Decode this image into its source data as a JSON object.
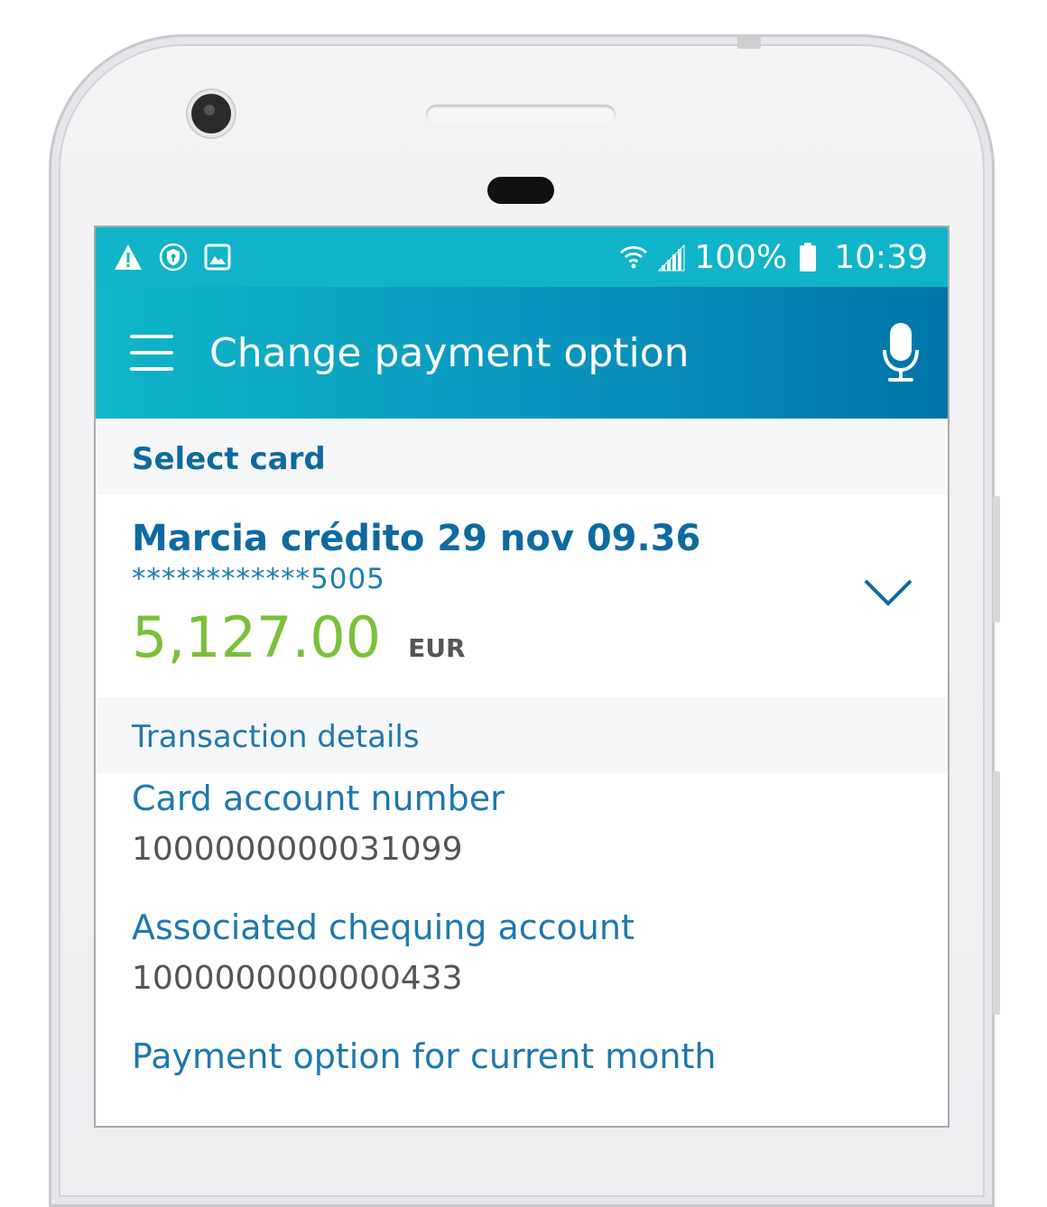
{
  "status_bar": {
    "left_icons": [
      "warning-icon",
      "shield-icon",
      "image-icon"
    ],
    "battery": "100%",
    "time": "10:39"
  },
  "app_bar": {
    "title": "Change payment option",
    "menu_icon": "hamburger-menu-icon",
    "voice_icon": "microphone-icon"
  },
  "select_card": {
    "header": "Select card",
    "card_name": "Marcia crédito 29 nov 09.36",
    "card_number_masked": "************5005",
    "balance": "5,127.00",
    "currency": "EUR"
  },
  "transaction_details": {
    "header": "Transaction details",
    "fields": [
      {
        "label": "Card account number",
        "value": "1000000000031099"
      },
      {
        "label": "Associated chequing account",
        "value": "1000000000000433"
      },
      {
        "label": "Payment option for current month",
        "value": ""
      }
    ]
  },
  "colors": {
    "status_bar": "#0fb4c8",
    "accent_blue": "#0e6aa0",
    "amount_green": "#7ac13a"
  }
}
